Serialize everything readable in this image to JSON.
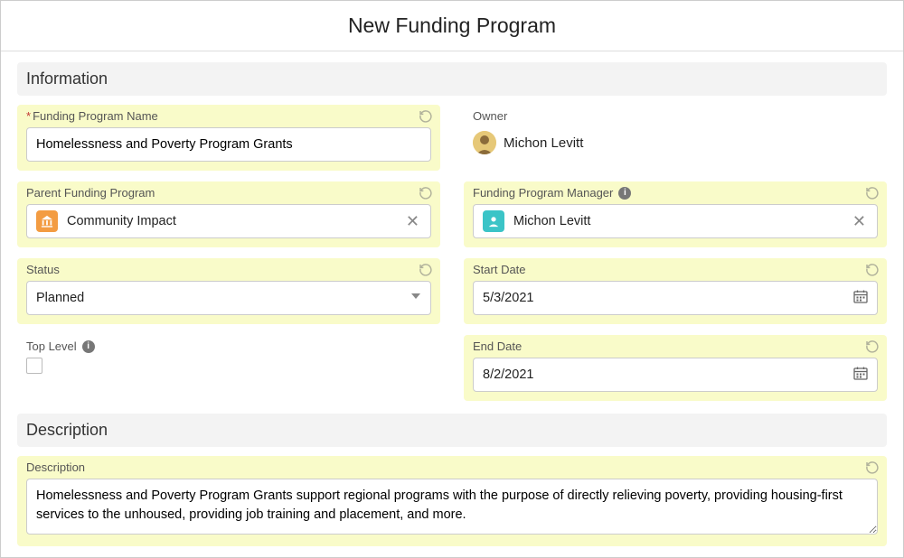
{
  "header": {
    "title": "New Funding Program"
  },
  "sections": {
    "information": "Information",
    "description": "Description"
  },
  "fields": {
    "name": {
      "label": "Funding Program Name",
      "value": "Homelessness and Poverty Program Grants"
    },
    "owner": {
      "label": "Owner",
      "value": "Michon Levitt"
    },
    "parent": {
      "label": "Parent Funding Program",
      "value": "Community Impact"
    },
    "manager": {
      "label": "Funding Program Manager",
      "value": "Michon Levitt"
    },
    "status": {
      "label": "Status",
      "value": "Planned"
    },
    "startDate": {
      "label": "Start Date",
      "value": "5/3/2021"
    },
    "topLevel": {
      "label": "Top Level"
    },
    "endDate": {
      "label": "End Date",
      "value": "8/2/2021"
    },
    "description": {
      "label": "Description",
      "value": "Homelessness and Poverty Program Grants support regional programs with the purpose of directly relieving poverty, providing housing-first services to the unhoused, providing job training and placement, and more."
    }
  }
}
